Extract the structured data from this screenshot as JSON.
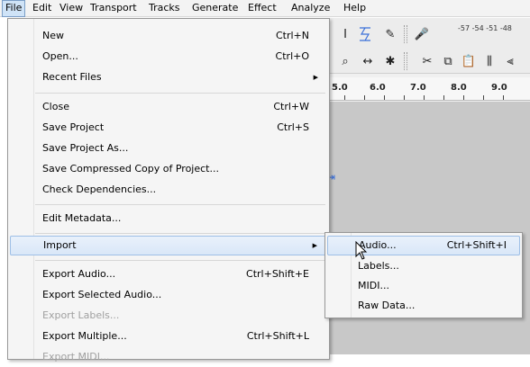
{
  "menubar": {
    "items": [
      "File",
      "Edit",
      "View",
      "Transport",
      "Tracks",
      "Generate",
      "Effect",
      "Analyze",
      "Help"
    ]
  },
  "toolbar": {
    "tools": [
      "selection-tool-icon",
      "envelope-tool-icon",
      "draw-tool-icon",
      "zoom-tool-icon",
      "timeshift-tool-icon",
      "multi-tool-icon"
    ],
    "meter_label": "-57 -54 -51 -48"
  },
  "ruler": {
    "labels": [
      "5.0",
      "6.0",
      "7.0",
      "8.0",
      "9.0"
    ]
  },
  "file_menu": {
    "items": [
      {
        "label": "New",
        "shortcut": "Ctrl+N"
      },
      {
        "label": "Open...",
        "shortcut": "Ctrl+O"
      },
      {
        "label": "Recent Files",
        "shortcut": ""
      },
      {
        "label": "Close",
        "shortcut": "Ctrl+W"
      },
      {
        "label": "Save Project",
        "shortcut": "Ctrl+S"
      },
      {
        "label": "Save Project As...",
        "shortcut": ""
      },
      {
        "label": "Save Compressed Copy of Project...",
        "shortcut": ""
      },
      {
        "label": "Check Dependencies...",
        "shortcut": ""
      },
      {
        "label": "Edit Metadata...",
        "shortcut": ""
      },
      {
        "label": "Import",
        "shortcut": ""
      },
      {
        "label": "Export Audio...",
        "shortcut": "Ctrl+Shift+E"
      },
      {
        "label": "Export Selected Audio...",
        "shortcut": ""
      },
      {
        "label": "Export Labels...",
        "shortcut": ""
      },
      {
        "label": "Export Multiple...",
        "shortcut": "Ctrl+Shift+L"
      },
      {
        "label": "Export MIDI...",
        "shortcut": ""
      }
    ]
  },
  "import_submenu": {
    "items": [
      {
        "label": "Audio...",
        "shortcut": "Ctrl+Shift+I"
      },
      {
        "label": "Labels...",
        "shortcut": ""
      },
      {
        "label": "MIDI...",
        "shortcut": ""
      },
      {
        "label": "Raw Data...",
        "shortcut": ""
      }
    ]
  },
  "colors": {
    "highlight": "#d9e7f8",
    "highlight_border": "#9ebfe6",
    "menu_bg": "#f5f5f5",
    "disabled_text": "#a0a0a0"
  }
}
